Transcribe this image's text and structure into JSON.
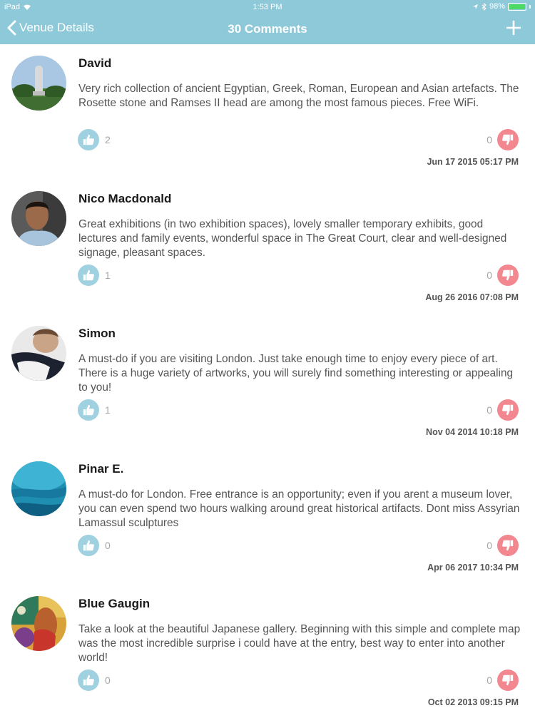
{
  "status_bar": {
    "device": "iPad",
    "time": "1:53 PM",
    "battery": "98%",
    "battery_level": 0.98
  },
  "nav": {
    "back_label": "Venue Details",
    "title": "30 Comments"
  },
  "colors": {
    "header": "#8ec9d9",
    "like": "#9fd1e0",
    "dislike": "#f2878f"
  },
  "comments": [
    {
      "author": "David",
      "text": "Very rich collection of ancient Egyptian, Greek, Roman, European and Asian artefacts. The Rosette stone and Ramses II head are among the most famous pieces. Free WiFi.",
      "likes": "2",
      "dislikes": "0",
      "date": "Jun 17 2015 05:17 PM"
    },
    {
      "author": "Nico Macdonald",
      "text": "Great exhibitions (in two exhibition spaces), lovely smaller temporary exhibits, good lectures and family events, wonderful space in The Great Court, clear and well-designed signage, pleasant spaces.",
      "likes": "1",
      "dislikes": "0",
      "date": "Aug 26 2016 07:08 PM"
    },
    {
      "author": "Simon",
      "text": "A must-do if you are visiting London. Just take enough time to enjoy every piece of art. There is a huge variety of artworks, you will surely find something interesting or appealing to you!",
      "likes": "1",
      "dislikes": "0",
      "date": "Nov 04 2014 10:18 PM"
    },
    {
      "author": "Pinar E.",
      "text": "A must-do for London. Free entrance is an opportunity; even if you arent a museum lover, you can even spend two hours walking around great historical artifacts. Dont miss Assyrian Lamassul sculptures",
      "likes": "0",
      "dislikes": "0",
      "date": "Apr 06 2017 10:34 PM"
    },
    {
      "author": "Blue Gaugin",
      "text": "Take a look at the beautiful Japanese gallery. Beginning with this simple and complete map was the most incredible surprise i could have at the entry, best way to enter into another world!",
      "likes": "0",
      "dislikes": "0",
      "date": "Oct 02 2013 09:15 PM"
    }
  ]
}
